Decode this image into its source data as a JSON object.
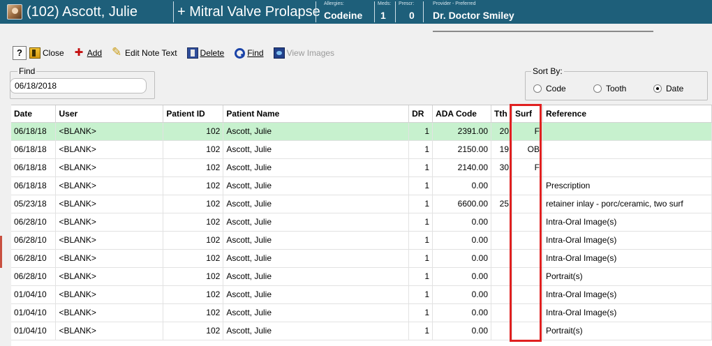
{
  "header": {
    "patient_name": "(102) Ascott, Julie",
    "condition": "+ Mitral Valve Prolapse",
    "allergies_label": "Allergies:",
    "allergies_value": "Codeine",
    "meds_label": "Meds:",
    "meds_value": "1",
    "prescr_label": "Prescr:",
    "prescr_value": "0",
    "provider_label": "Provider - Preferred",
    "provider_value": "Dr. Doctor Smiley"
  },
  "toolbar": {
    "help": "?",
    "close": "Close",
    "add": "Add",
    "edit_note_text": "Edit Note Text",
    "delete": "Delete",
    "find": "Find",
    "view_images": "View Images"
  },
  "find": {
    "label": "Find",
    "value": "06/18/2018"
  },
  "sort": {
    "label": "Sort By:",
    "options": [
      "Code",
      "Tooth",
      "Date"
    ],
    "selected": "Date"
  },
  "grid": {
    "columns": [
      "Date",
      "User",
      "Patient ID",
      "Patient Name",
      "DR",
      "ADA Code",
      "Tth",
      "Surf",
      "Reference"
    ],
    "rows": [
      {
        "date": "06/18/18",
        "user": "<BLANK>",
        "pid": "102",
        "name": "Ascott, Julie",
        "dr": "1",
        "ada": "2391.00",
        "tth": "20",
        "surf": "F",
        "ref": ""
      },
      {
        "date": "06/18/18",
        "user": "<BLANK>",
        "pid": "102",
        "name": "Ascott, Julie",
        "dr": "1",
        "ada": "2150.00",
        "tth": "19",
        "surf": "OB",
        "ref": ""
      },
      {
        "date": "06/18/18",
        "user": "<BLANK>",
        "pid": "102",
        "name": "Ascott, Julie",
        "dr": "1",
        "ada": "2140.00",
        "tth": "30",
        "surf": "F",
        "ref": ""
      },
      {
        "date": "06/18/18",
        "user": "<BLANK>",
        "pid": "102",
        "name": "Ascott, Julie",
        "dr": "1",
        "ada": "0.00",
        "tth": "",
        "surf": "",
        "ref": "Prescription"
      },
      {
        "date": "05/23/18",
        "user": "<BLANK>",
        "pid": "102",
        "name": "Ascott, Julie",
        "dr": "1",
        "ada": "6600.00",
        "tth": "25",
        "surf": "",
        "ref": "retainer inlay - porc/ceramic, two surf"
      },
      {
        "date": "06/28/10",
        "user": "<BLANK>",
        "pid": "102",
        "name": "Ascott, Julie",
        "dr": "1",
        "ada": "0.00",
        "tth": "",
        "surf": "",
        "ref": "Intra-Oral Image(s)"
      },
      {
        "date": "06/28/10",
        "user": "<BLANK>",
        "pid": "102",
        "name": "Ascott, Julie",
        "dr": "1",
        "ada": "0.00",
        "tth": "",
        "surf": "",
        "ref": "Intra-Oral Image(s)"
      },
      {
        "date": "06/28/10",
        "user": "<BLANK>",
        "pid": "102",
        "name": "Ascott, Julie",
        "dr": "1",
        "ada": "0.00",
        "tth": "",
        "surf": "",
        "ref": "Intra-Oral Image(s)"
      },
      {
        "date": "06/28/10",
        "user": "<BLANK>",
        "pid": "102",
        "name": "Ascott, Julie",
        "dr": "1",
        "ada": "0.00",
        "tth": "",
        "surf": "",
        "ref": "Portrait(s)"
      },
      {
        "date": "01/04/10",
        "user": "<BLANK>",
        "pid": "102",
        "name": "Ascott, Julie",
        "dr": "1",
        "ada": "0.00",
        "tth": "",
        "surf": "",
        "ref": "Intra-Oral Image(s)"
      },
      {
        "date": "01/04/10",
        "user": "<BLANK>",
        "pid": "102",
        "name": "Ascott, Julie",
        "dr": "1",
        "ada": "0.00",
        "tth": "",
        "surf": "",
        "ref": "Intra-Oral Image(s)"
      },
      {
        "date": "01/04/10",
        "user": "<BLANK>",
        "pid": "102",
        "name": "Ascott, Julie",
        "dr": "1",
        "ada": "0.00",
        "tth": "",
        "surf": "",
        "ref": "Portrait(s)"
      }
    ],
    "selected_row": 0
  },
  "colors": {
    "header_bg": "#1e5f7a",
    "selected_row": "#c7f1ce",
    "highlight_box": "#e02020"
  }
}
